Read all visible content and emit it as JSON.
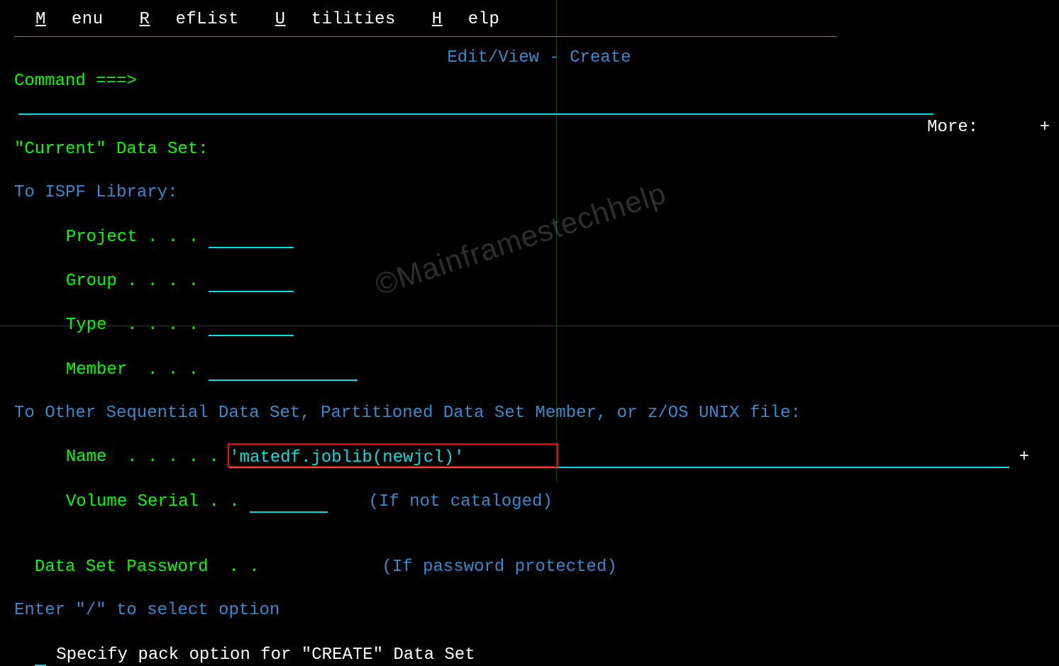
{
  "menubar": {
    "menu": "Menu",
    "reflist": "RefList",
    "utilities": "Utilities",
    "help": "Help"
  },
  "title": "Edit/View - Create",
  "command_label": "Command ===>",
  "command_value": "",
  "more_label": "More:",
  "more_indicator": "+",
  "current_ds_label": "\"Current\" Data Set:",
  "ispf": {
    "heading": "To ISPF Library:",
    "project_label": "Project . . .",
    "project_value": "",
    "group_label": "Group . . . .",
    "group_value": "",
    "type_label": "Type  . . . .",
    "type_value": "",
    "member_label": "Member  . . .",
    "member_value": ""
  },
  "other": {
    "heading": "To Other Sequential Data Set, Partitioned Data Set Member, or z/OS UNIX file:",
    "name_label": "Name  . . . . .",
    "name_value": "'matedf.joblib(newjcl)'",
    "name_more": "+",
    "volser_label": "Volume Serial . .",
    "volser_value": "",
    "volser_hint": "(If not cataloged)"
  },
  "password": {
    "label": "Data Set Password  . .",
    "hint": "(If password protected)"
  },
  "option": {
    "heading": "Enter \"/\" to select option",
    "value": "",
    "text": "Specify pack option for \"CREATE\" Data Set"
  },
  "watermark": "©Mainframestechhelp"
}
